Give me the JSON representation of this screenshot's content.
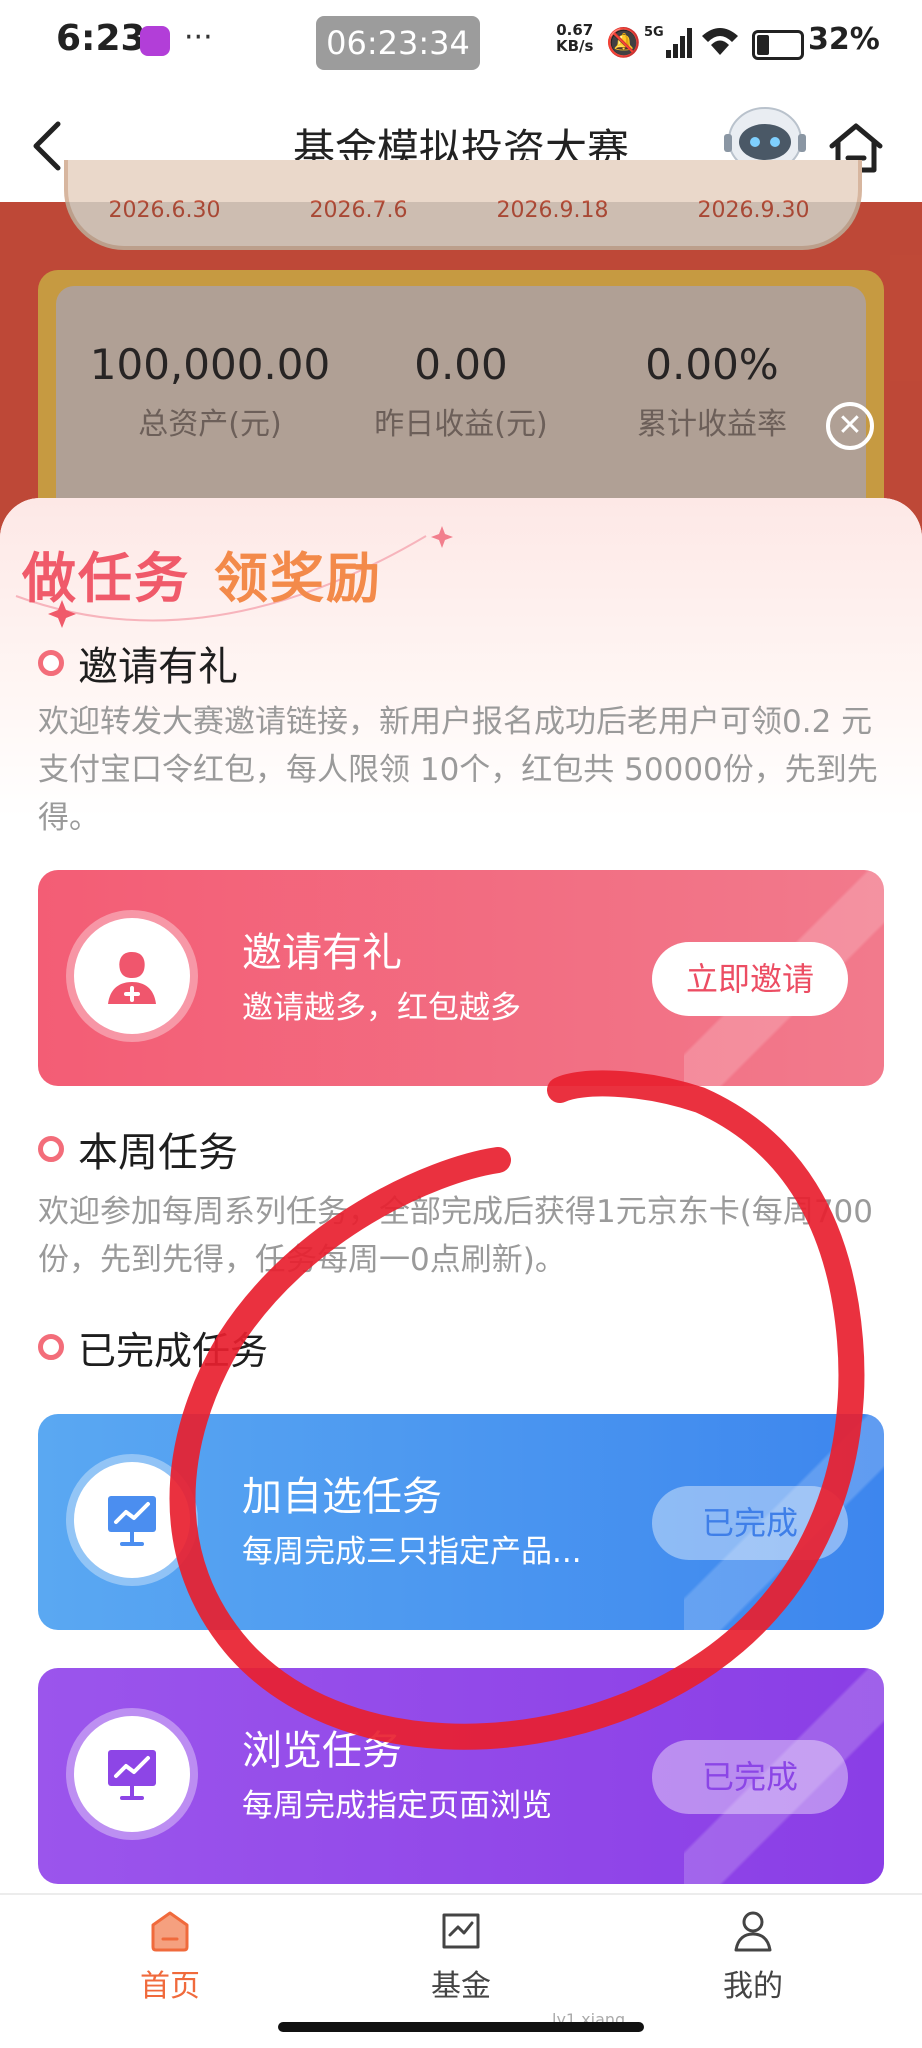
{
  "status_bar": {
    "time": "6:23",
    "dots": "···",
    "clock": "06:23:34",
    "net_speed_value": "0.67",
    "net_speed_unit": "KB/s",
    "network": "5G",
    "battery": "32%"
  },
  "nav": {
    "title": "基金模拟投资大赛",
    "back_icon": "chevron-left-icon",
    "mascot_icon": "robot-mascot-icon",
    "home_icon": "home-icon"
  },
  "schedule": {
    "dates": [
      "2026.6.30",
      "2026.7.6",
      "2026.9.18",
      "2026.9.30"
    ]
  },
  "stats": {
    "total_assets_value": "100,000.00",
    "total_assets_label": "总资产(元)",
    "yesterday_income_value": "0.00",
    "yesterday_income_label": "昨日收益(元)",
    "cumulative_rate_value": "0.00%",
    "cumulative_rate_label": "累计收益率"
  },
  "sheet": {
    "title_part1": "做任务",
    "title_part2": "领奖励",
    "invite_section": {
      "heading": "邀请有礼",
      "desc": "欢迎转发大赛邀请链接，新用户报名成功后老用户可领0.2 元支付宝口令红包，每人限领 10个，红包共 50000份，先到先得。",
      "card_title": "邀请有礼",
      "card_sub": "邀请越多，红包越多",
      "button": "立即邀请"
    },
    "weekly_section": {
      "heading": "本周任务",
      "desc": "欢迎参加每周系列任务，全部完成后获得1元京东卡(每周700份，先到先得，任务每周一0点刷新)。"
    },
    "completed_section": {
      "heading": "已完成任务",
      "tasks": [
        {
          "title": "加自选任务",
          "sub": "每周完成三只指定产品...",
          "status": "已完成"
        },
        {
          "title": "浏览任务",
          "sub": "每周完成指定页面浏览",
          "status": "已完成"
        }
      ]
    }
  },
  "tabbar": {
    "tabs": [
      {
        "label": "首页",
        "icon": "home-tab-icon",
        "active": true
      },
      {
        "label": "基金",
        "icon": "fund-tab-icon",
        "active": false
      },
      {
        "label": "我的",
        "icon": "profile-tab-icon",
        "active": false
      }
    ]
  },
  "watermark": "ly1 xiang",
  "colors": {
    "accent_red": "#f05a6a",
    "accent_orange": "#f38a4a",
    "invite_card": "#f35d75",
    "fav_card": "#4a96f0",
    "browse_card": "#9449e9",
    "tab_active": "#f06a3c",
    "annotation_circle": "#e8202f"
  }
}
